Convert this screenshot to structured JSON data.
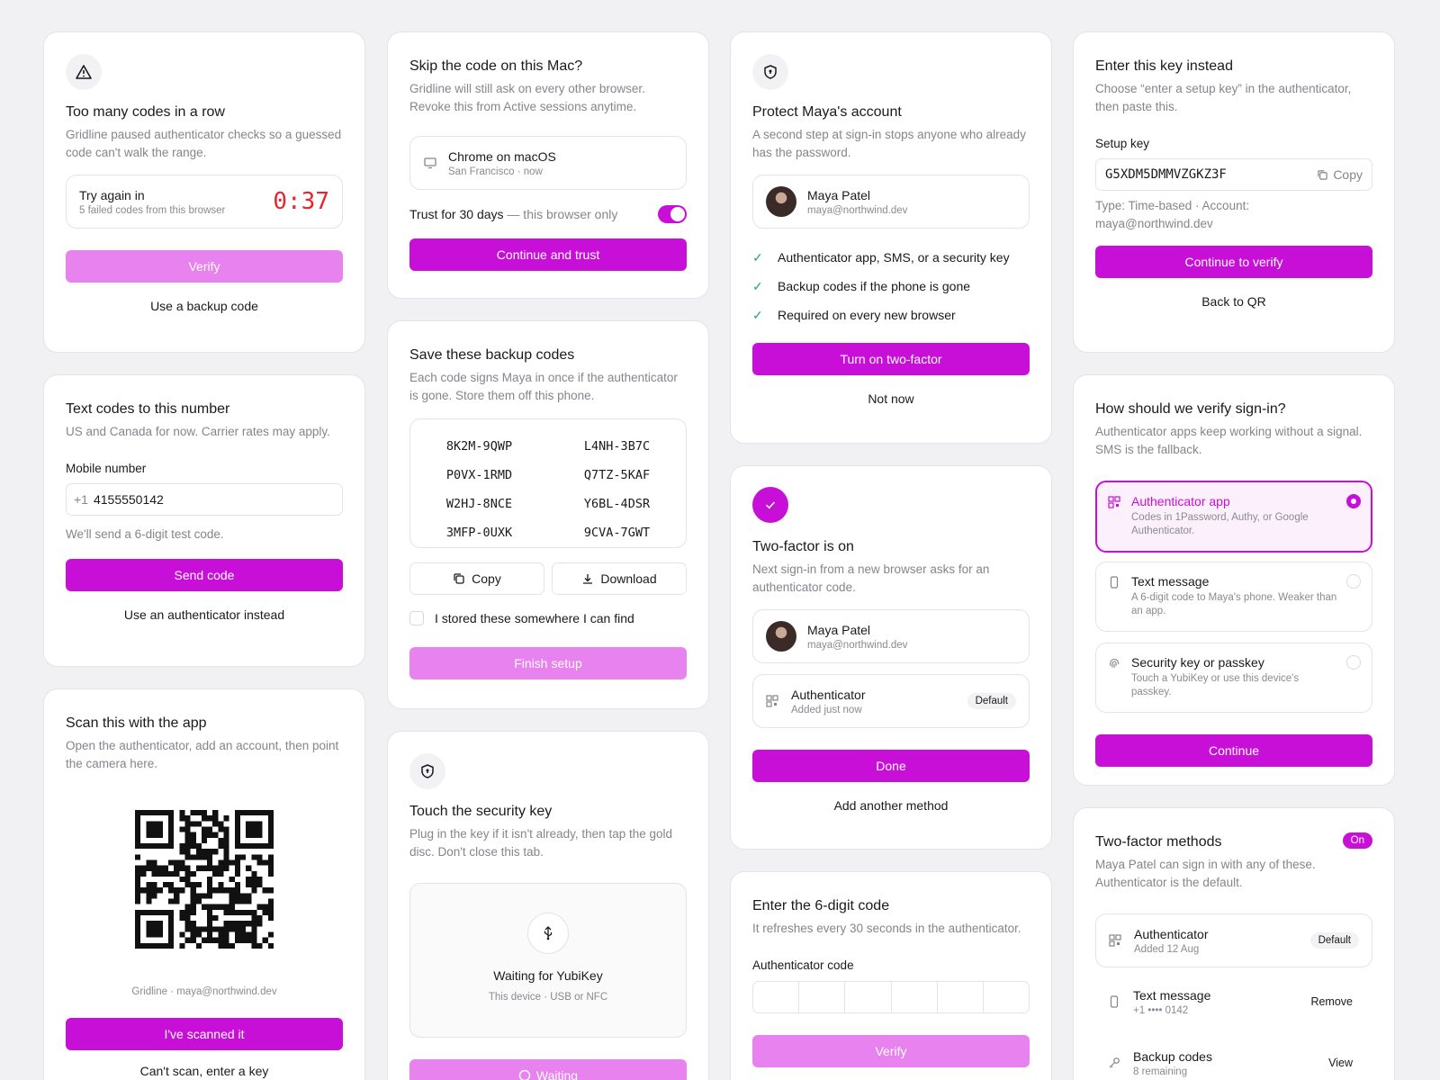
{
  "c1": {
    "title": "Too many codes in a row",
    "desc": "Gridline paused authenticator checks so a guessed code can't walk the range.",
    "try_label": "Try again in",
    "try_sub": "5 failed codes from this browser",
    "timer": "0:37",
    "verify": "Verify",
    "backup_link": "Use a backup code"
  },
  "c2": {
    "title": "Text codes to this number",
    "desc": "US and Canada for now. Carrier rates may apply.",
    "field_label": "Mobile number",
    "prefix": "+1",
    "phone": "4155550142",
    "hint": "We'll send a 6-digit test code.",
    "send": "Send code",
    "alt_link": "Use an authenticator instead"
  },
  "c3": {
    "title": "Scan this with the app",
    "desc": "Open the authenticator, add an account, then point the camera here.",
    "caption": "Gridline · maya@northwind.dev",
    "scanned": "I've scanned it",
    "cant_scan": "Can't scan, enter a key"
  },
  "c4": {
    "title": "Skip the code on this Mac?",
    "desc": "Gridline will still ask on every other browser. Revoke this from Active sessions anytime.",
    "device": "Chrome on macOS",
    "device_sub": "San Francisco · now",
    "trust_label": "Trust for 30 days",
    "trust_sub": "— this browser only",
    "continue": "Continue and trust"
  },
  "c5": {
    "title": "Save these backup codes",
    "desc": "Each code signs Maya in once if the authenticator is gone. Store them off this phone.",
    "codes": [
      "8K2M-9QWP",
      "L4NH-3B7C",
      "P0VX-1RMD",
      "Q7TZ-5KAF",
      "W2HJ-8NCE",
      "Y6BL-4DSR",
      "3MFP-0UXK",
      "9CVA-7GWT"
    ],
    "copy": "Copy",
    "download": "Download",
    "stored": "I stored these somewhere I can find",
    "finish": "Finish setup"
  },
  "c6": {
    "title": "Touch the security key",
    "desc": "Plug in the key if it isn't already, then tap the gold disc. Don't close this tab.",
    "waiting_title": "Waiting for YubiKey",
    "waiting_sub": "This device · USB or NFC",
    "waiting_btn": "Waiting"
  },
  "c7": {
    "title": "Protect Maya's account",
    "desc": "A second step at sign-in stops anyone who already has the password.",
    "name": "Maya Patel",
    "email": "maya@northwind.dev",
    "features": [
      "Authenticator app, SMS, or a security key",
      "Backup codes if the phone is gone",
      "Required on every new browser"
    ],
    "turn_on": "Turn on two-factor",
    "not_now": "Not now"
  },
  "c8": {
    "title": "Two-factor is on",
    "desc": "Next sign-in from a new browser asks for an authenticator code.",
    "name": "Maya Patel",
    "email": "maya@northwind.dev",
    "method": "Authenticator",
    "method_sub": "Added just now",
    "default_badge": "Default",
    "done": "Done",
    "add": "Add another method"
  },
  "c9": {
    "title": "Enter the 6-digit code",
    "desc": "It refreshes every 30 seconds in the authenticator.",
    "field_label": "Authenticator code",
    "verify": "Verify"
  },
  "c10": {
    "title": "Enter this key instead",
    "desc": "Choose “enter a setup key” in the authenticator, then paste this.",
    "field_label": "Setup key",
    "key": "G5XDM5DMMVZGKZ3F",
    "copy": "Copy",
    "meta": "Type: Time-based · Account: maya@northwind.dev",
    "continue": "Continue to verify",
    "back": "Back to QR"
  },
  "c11": {
    "title": "How should we verify sign-in?",
    "desc": "Authenticator apps keep working without a signal. SMS is the fallback.",
    "options": [
      {
        "title": "Authenticator app",
        "sub": "Codes in 1Password, Authy, or Google Authenticator."
      },
      {
        "title": "Text message",
        "sub": "A 6-digit code to Maya's phone. Weaker than an app."
      },
      {
        "title": "Security key or passkey",
        "sub": "Touch a YubiKey or use this device's passkey."
      }
    ],
    "continue": "Continue"
  },
  "c12": {
    "title": "Two-factor methods",
    "status": "On",
    "desc": "Maya Patel can sign in with any of these. Authenticator is the default.",
    "methods": [
      {
        "title": "Authenticator",
        "sub": "Added 12 Aug",
        "action": "Default"
      },
      {
        "title": "Text message",
        "sub": "+1 •••• 0142",
        "action": "Remove"
      },
      {
        "title": "Backup codes",
        "sub": "8 remaining",
        "action": "View"
      }
    ]
  },
  "colors": {
    "accent": "#c80fd8",
    "accent_disabled": "#e882ef",
    "danger": "#e5262e",
    "success": "#1fa86b"
  }
}
